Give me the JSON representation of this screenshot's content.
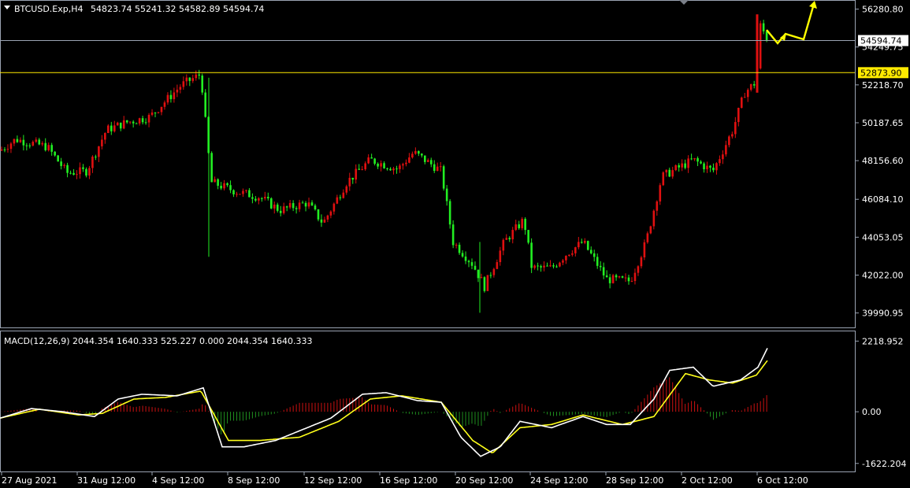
{
  "header": {
    "symbol_text": "BTCUSD.Exp,H4",
    "ohlc_text": "54823.74 55241.32 54582.89 54594.74"
  },
  "price_axis": {
    "ticks": [
      "56280.80",
      "54249.75",
      "52218.70",
      "50187.65",
      "48156.60",
      "46084.10",
      "44053.05",
      "42022.00",
      "39990.95"
    ],
    "tick_values": [
      56280.8,
      54249.75,
      52218.7,
      50187.65,
      48156.6,
      46084.1,
      44053.05,
      42022.0,
      39990.95
    ],
    "ylim": [
      39300,
      56600
    ]
  },
  "current_price": {
    "label": "54594.74",
    "value": 54594.74,
    "color": "#9aa3b2"
  },
  "level_line": {
    "label": "52873.90",
    "value": 52873.9,
    "color": "#ffea00"
  },
  "macd_panel": {
    "label": "MACD(12,26,9) 2044.354 1640.333 525.227 0.000 2044.354 1640.333",
    "ticks": [
      "2218.952",
      "0.00",
      "-1622.204"
    ],
    "tick_values": [
      2218.952,
      0,
      -1622.204
    ],
    "ylim": [
      -1850,
      2450
    ]
  },
  "time_axis": {
    "labels": [
      "27 Aug 2021",
      "31 Aug 12:00",
      "4 Sep 12:00",
      "8 Sep 12:00",
      "12 Sep 12:00",
      "16 Sep 12:00",
      "20 Sep 12:00",
      "24 Sep 12:00",
      "28 Sep 12:00",
      "2 Oct 12:00",
      "6 Oct 12:00"
    ]
  },
  "colors": {
    "bull": "#e01010",
    "bear": "#22ee22",
    "hist_pos": "#cc1111",
    "hist_neg": "#1f8f1f",
    "macd_line": "#ffffff",
    "signal_line": "#ffff1a",
    "forecast_arrow": "#ffff00",
    "grid_border": "#9aa3b2"
  },
  "chart_data": [
    {
      "type": "candlestick",
      "title": "BTCUSD.Exp,H4",
      "x": [
        "27 Aug 2021",
        "31 Aug 12:00",
        "4 Sep 12:00",
        "8 Sep 12:00",
        "12 Sep 12:00",
        "16 Sep 12:00",
        "20 Sep 12:00",
        "24 Sep 12:00",
        "28 Sep 12:00",
        "2 Oct 12:00",
        "6 Oct 12:00"
      ],
      "close_path": [
        [
          0,
          48700
        ],
        [
          20,
          49300
        ],
        [
          60,
          48900
        ],
        [
          85,
          47500
        ],
        [
          110,
          47600
        ],
        [
          135,
          49800
        ],
        [
          160,
          50200
        ],
        [
          190,
          50500
        ],
        [
          230,
          52200
        ],
        [
          255,
          52800
        ],
        [
          268,
          47000
        ],
        [
          300,
          46500
        ],
        [
          330,
          46200
        ],
        [
          355,
          45500
        ],
        [
          390,
          45900
        ],
        [
          410,
          44800
        ],
        [
          440,
          47000
        ],
        [
          470,
          48200
        ],
        [
          505,
          47700
        ],
        [
          525,
          48600
        ],
        [
          560,
          47600
        ],
        [
          575,
          43800
        ],
        [
          600,
          42600
        ],
        [
          615,
          41400
        ],
        [
          640,
          43800
        ],
        [
          665,
          45000
        ],
        [
          675,
          42400
        ],
        [
          700,
          42400
        ],
        [
          720,
          43200
        ],
        [
          740,
          43800
        ],
        [
          770,
          41800
        ],
        [
          800,
          41700
        ],
        [
          820,
          43800
        ],
        [
          840,
          47300
        ],
        [
          880,
          48200
        ],
        [
          905,
          47600
        ],
        [
          930,
          49800
        ],
        [
          945,
          51800
        ],
        [
          960,
          52400
        ],
        [
          965,
          55400
        ],
        [
          975,
          54600
        ]
      ],
      "ylim": [
        39300,
        56600
      ],
      "current_price": 54594.74,
      "level": 52873.9
    },
    {
      "type": "macd",
      "title": "MACD(12,26,9) 2044.354 1640.333 525.227 0.000 2044.354 1640.333",
      "macd_path": [
        [
          0,
          -200
        ],
        [
          40,
          100
        ],
        [
          80,
          0
        ],
        [
          120,
          -150
        ],
        [
          150,
          400
        ],
        [
          180,
          550
        ],
        [
          225,
          500
        ],
        [
          258,
          750
        ],
        [
          282,
          -1100
        ],
        [
          310,
          -1100
        ],
        [
          350,
          -900
        ],
        [
          390,
          -500
        ],
        [
          420,
          -200
        ],
        [
          460,
          550
        ],
        [
          490,
          600
        ],
        [
          530,
          350
        ],
        [
          560,
          300
        ],
        [
          585,
          -800
        ],
        [
          610,
          -1400
        ],
        [
          635,
          -1100
        ],
        [
          660,
          -300
        ],
        [
          700,
          -500
        ],
        [
          740,
          -150
        ],
        [
          770,
          -400
        ],
        [
          800,
          -400
        ],
        [
          830,
          400
        ],
        [
          850,
          1300
        ],
        [
          880,
          1400
        ],
        [
          905,
          800
        ],
        [
          940,
          1000
        ],
        [
          962,
          1400
        ],
        [
          975,
          2044
        ]
      ],
      "signal_path": [
        [
          0,
          -200
        ],
        [
          50,
          80
        ],
        [
          100,
          -100
        ],
        [
          130,
          -50
        ],
        [
          170,
          400
        ],
        [
          210,
          450
        ],
        [
          255,
          650
        ],
        [
          290,
          -900
        ],
        [
          330,
          -900
        ],
        [
          380,
          -800
        ],
        [
          430,
          -300
        ],
        [
          470,
          400
        ],
        [
          510,
          500
        ],
        [
          560,
          300
        ],
        [
          600,
          -900
        ],
        [
          625,
          -1300
        ],
        [
          660,
          -500
        ],
        [
          700,
          -400
        ],
        [
          740,
          -100
        ],
        [
          790,
          -400
        ],
        [
          830,
          -150
        ],
        [
          870,
          1200
        ],
        [
          900,
          1000
        ],
        [
          930,
          900
        ],
        [
          960,
          1150
        ],
        [
          975,
          1640
        ]
      ],
      "ylim": [
        -1850,
        2450
      ]
    }
  ]
}
